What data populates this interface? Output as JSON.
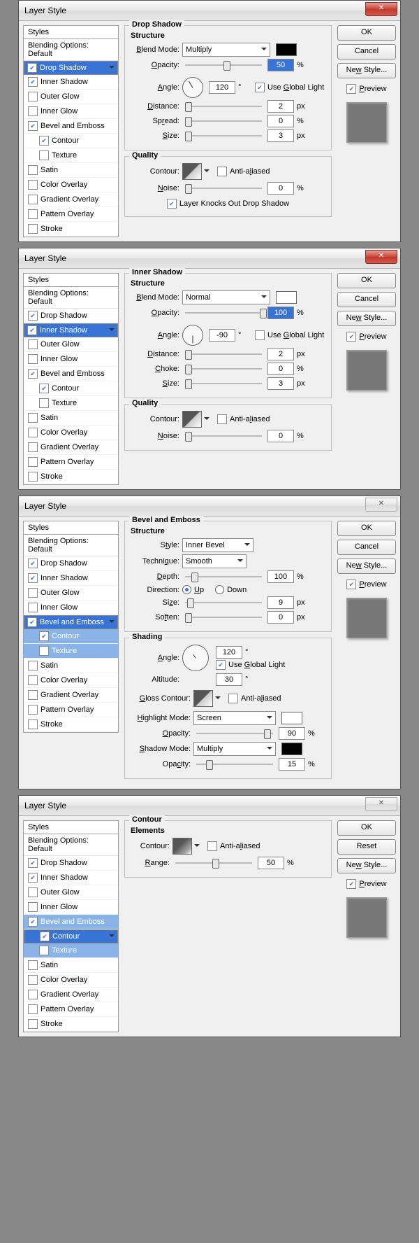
{
  "title": "Layer Style",
  "styles_header": "Styles",
  "blending": "Blending Options: Default",
  "items": [
    "Drop Shadow",
    "Inner Shadow",
    "Outer Glow",
    "Inner Glow",
    "Bevel and Emboss",
    "Contour",
    "Texture",
    "Satin",
    "Color Overlay",
    "Gradient Overlay",
    "Pattern Overlay",
    "Stroke"
  ],
  "buttons": {
    "ok": "OK",
    "cancel": "Cancel",
    "reset": "Reset",
    "newstyle": "New Style...",
    "preview": "Preview"
  },
  "p1": {
    "head": "Drop Shadow",
    "sub": "Structure",
    "blendmode": "Blend Mode:",
    "blendval": "Multiply",
    "opacity_l": "Opacity:",
    "opacity": "50",
    "angle_l": "Angle:",
    "angle": "120",
    "globallight": "Use Global Light",
    "distance_l": "Distance:",
    "distance": "2",
    "spread_l": "Spread:",
    "spread": "0",
    "size_l": "Size:",
    "size": "3",
    "quality": "Quality",
    "contour_l": "Contour:",
    "anti": "Anti-aliased",
    "noise_l": "Noise:",
    "noise": "0",
    "knock": "Layer Knocks Out Drop Shadow",
    "pct": "%",
    "px": "px",
    "deg": "°"
  },
  "p2": {
    "head": "Inner Shadow",
    "sub": "Structure",
    "blendmode": "Blend Mode:",
    "blendval": "Normal",
    "opacity_l": "Opacity:",
    "opacity": "100",
    "angle_l": "Angle:",
    "angle": "-90",
    "globallight": "Use Global Light",
    "distance_l": "Distance:",
    "distance": "2",
    "choke_l": "Choke:",
    "choke": "0",
    "size_l": "Size:",
    "size": "3",
    "quality": "Quality",
    "contour_l": "Contour:",
    "anti": "Anti-aliased",
    "noise_l": "Noise:",
    "noise": "0",
    "pct": "%",
    "px": "px",
    "deg": "°"
  },
  "p3": {
    "head": "Bevel and Emboss",
    "sub": "Structure",
    "style_l": "Style:",
    "style": "Inner Bevel",
    "tech_l": "Technique:",
    "tech": "Smooth",
    "depth_l": "Depth:",
    "depth": "100",
    "dir_l": "Direction:",
    "up": "Up",
    "down": "Down",
    "size_l": "Size:",
    "size": "9",
    "soften_l": "Soften:",
    "soften": "0",
    "shading": "Shading",
    "angle_l": "Angle:",
    "angle": "120",
    "globallight": "Use Global Light",
    "alt_l": "Altitude:",
    "alt": "30",
    "gloss_l": "Gloss Contour:",
    "anti": "Anti-aliased",
    "hmode_l": "Highlight Mode:",
    "hmode": "Screen",
    "hop_l": "Opacity:",
    "hop": "90",
    "smode_l": "Shadow Mode:",
    "smode": "Multiply",
    "sop_l": "Opacity:",
    "sop": "15",
    "pct": "%",
    "px": "px",
    "deg": "°"
  },
  "p4": {
    "head": "Contour",
    "sub": "Elements",
    "contour_l": "Contour:",
    "anti": "Anti-aliased",
    "range_l": "Range:",
    "range": "50",
    "pct": "%"
  }
}
